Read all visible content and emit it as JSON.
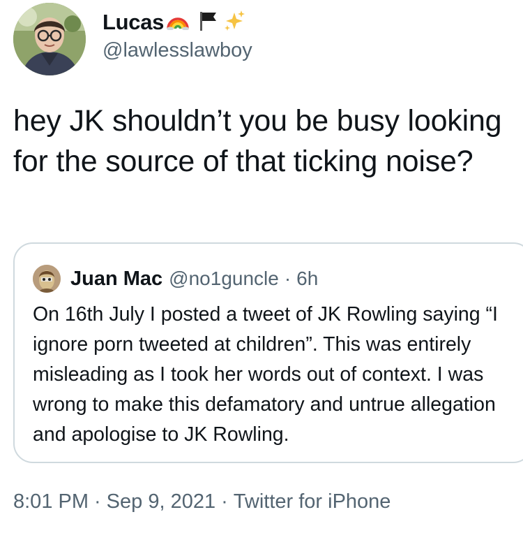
{
  "tweet": {
    "author": {
      "display_name": "Lucas",
      "handle": "@lawlesslawboy",
      "name_emojis": [
        "rainbow-emoji",
        "black-flag-emoji",
        "sparkles-emoji"
      ]
    },
    "text": "hey JK shouldn’t you be busy looking for the source of that ticking noise?",
    "quoted_tweet": {
      "display_name": "Juan Mac",
      "handle": "@no1guncle",
      "separator": "·",
      "time_ago": "6h",
      "text": "On 16th July I posted a tweet of JK Rowling saying “I ignore porn tweeted at children”. This was entirely misleading as I took her words out of context. I was wrong to make this defamatory and untrue allegation and apologise to JK Rowling."
    },
    "footer": {
      "time": "8:01 PM",
      "separator": "·",
      "date": "Sep 9, 2021",
      "source": "Twitter for iPhone"
    }
  },
  "colors": {
    "text_primary": "#0f1419",
    "text_secondary": "#536471",
    "border": "#cfd9de",
    "background": "#ffffff"
  }
}
